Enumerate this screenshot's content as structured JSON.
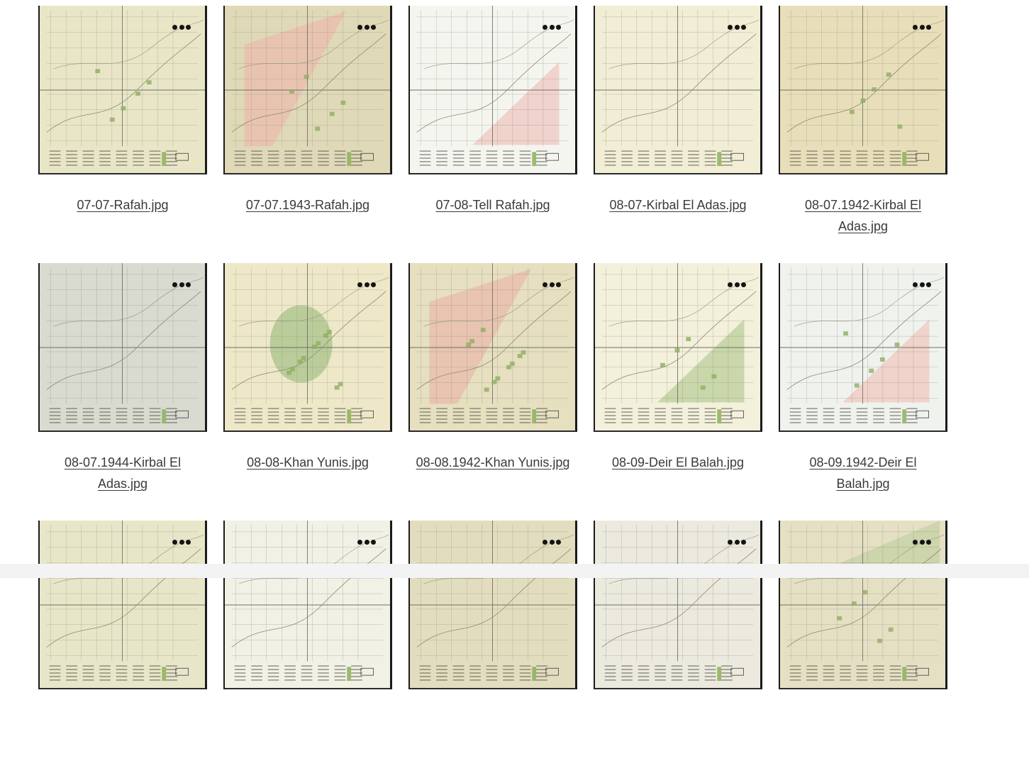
{
  "more_icon": "more-horizontal-icon",
  "files": [
    {
      "name": "07-07-Rafah.jpg",
      "paper": "#e9e6c7",
      "tint": "#e7dcc0",
      "tint_shape": "none",
      "green": 1
    },
    {
      "name": "07-07.1943-Rafah.jpg",
      "paper": "#e0d9b8",
      "tint": "#e9c0ae",
      "tint_shape": "upper-left",
      "green": 1
    },
    {
      "name": "07-08-Tell Rafah.jpg",
      "paper": "#f5f5f0",
      "tint": "#f0cfc8",
      "tint_shape": "lower-right",
      "green": 0
    },
    {
      "name": "08-07-Kirbal El Adas.jpg",
      "paper": "#f1eed5",
      "tint": "#ece5c6",
      "tint_shape": "none",
      "green": 0
    },
    {
      "name": "08-07.1942-Kirbal El Adas.jpg",
      "paper": "#e8dfba",
      "tint": "#e5d9b1",
      "tint_shape": "none",
      "green": 1
    },
    {
      "name": "08-07.1944-Kirbal El Adas.jpg",
      "paper": "#d9dad0",
      "tint": "#d8d0c4",
      "tint_shape": "none",
      "green": 0
    },
    {
      "name": "08-08-Khan Yunis.jpg",
      "paper": "#eee8c9",
      "tint": "#a8c38a",
      "tint_shape": "center-green",
      "green": 2
    },
    {
      "name": "08-08.1942-Khan Yunis.jpg",
      "paper": "#e6dfc0",
      "tint": "#e8bfae",
      "tint_shape": "upper-left",
      "green": 2
    },
    {
      "name": "08-09-Deir El Balah.jpg",
      "paper": "#f3f0dc",
      "tint": "#c4d4a4",
      "tint_shape": "lower-right",
      "green": 1
    },
    {
      "name": "08-09.1942-Deir El Balah.jpg",
      "paper": "#f0f2ee",
      "tint": "#f0cfc7",
      "tint_shape": "lower-right",
      "green": 1
    },
    {
      "name": "",
      "paper": "#e8e6c9",
      "tint": "#e8e6c9",
      "tint_shape": "none",
      "green": 0
    },
    {
      "name": "",
      "paper": "#f2f1e6",
      "tint": "#f2f1e6",
      "tint_shape": "none",
      "green": 0
    },
    {
      "name": "",
      "paper": "#e3ddbf",
      "tint": "#e3ddbf",
      "tint_shape": "none",
      "green": 0
    },
    {
      "name": "",
      "paper": "#eceade",
      "tint": "#eceade",
      "tint_shape": "none",
      "green": 0
    },
    {
      "name": "",
      "paper": "#e5e0c4",
      "tint": "#c9d4a8",
      "tint_shape": "upper-right",
      "green": 1
    }
  ]
}
